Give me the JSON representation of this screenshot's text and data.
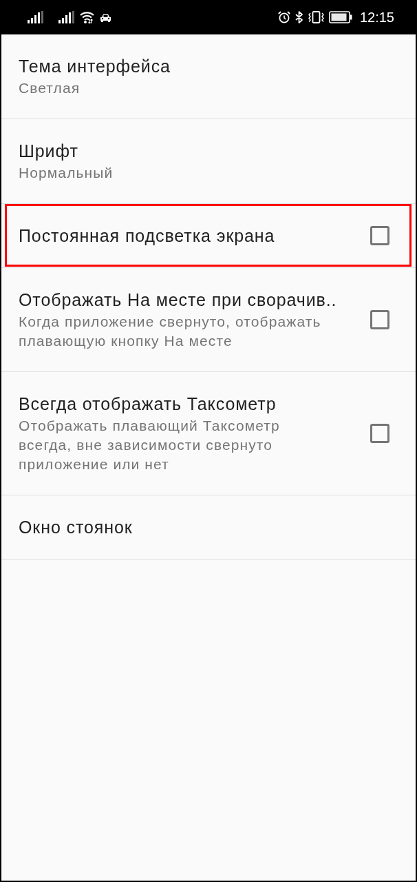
{
  "status_bar": {
    "time": "12:15"
  },
  "settings": [
    {
      "kind": "value",
      "title": "Тема интерфейса",
      "summary": "Светлая",
      "highlighted": false
    },
    {
      "kind": "value",
      "title": "Шрифт",
      "summary": "Нормальный",
      "highlighted": false
    },
    {
      "kind": "checkbox",
      "title": "Постоянная подсветка экрана",
      "checked": false,
      "highlighted": true
    },
    {
      "kind": "checkbox",
      "title": "Отображать На месте при сворачив..",
      "summary": "Когда приложение свернуто, отображать плавающую кнопку На месте",
      "checked": false,
      "highlighted": false
    },
    {
      "kind": "checkbox",
      "title": "Всегда отображать Таксометр",
      "summary": "Отображать плавающий Таксометр всегда, вне зависимости свернуто приложение или нет",
      "checked": false,
      "highlighted": false
    },
    {
      "kind": "link",
      "title": "Окно стоянок",
      "highlighted": false
    }
  ]
}
